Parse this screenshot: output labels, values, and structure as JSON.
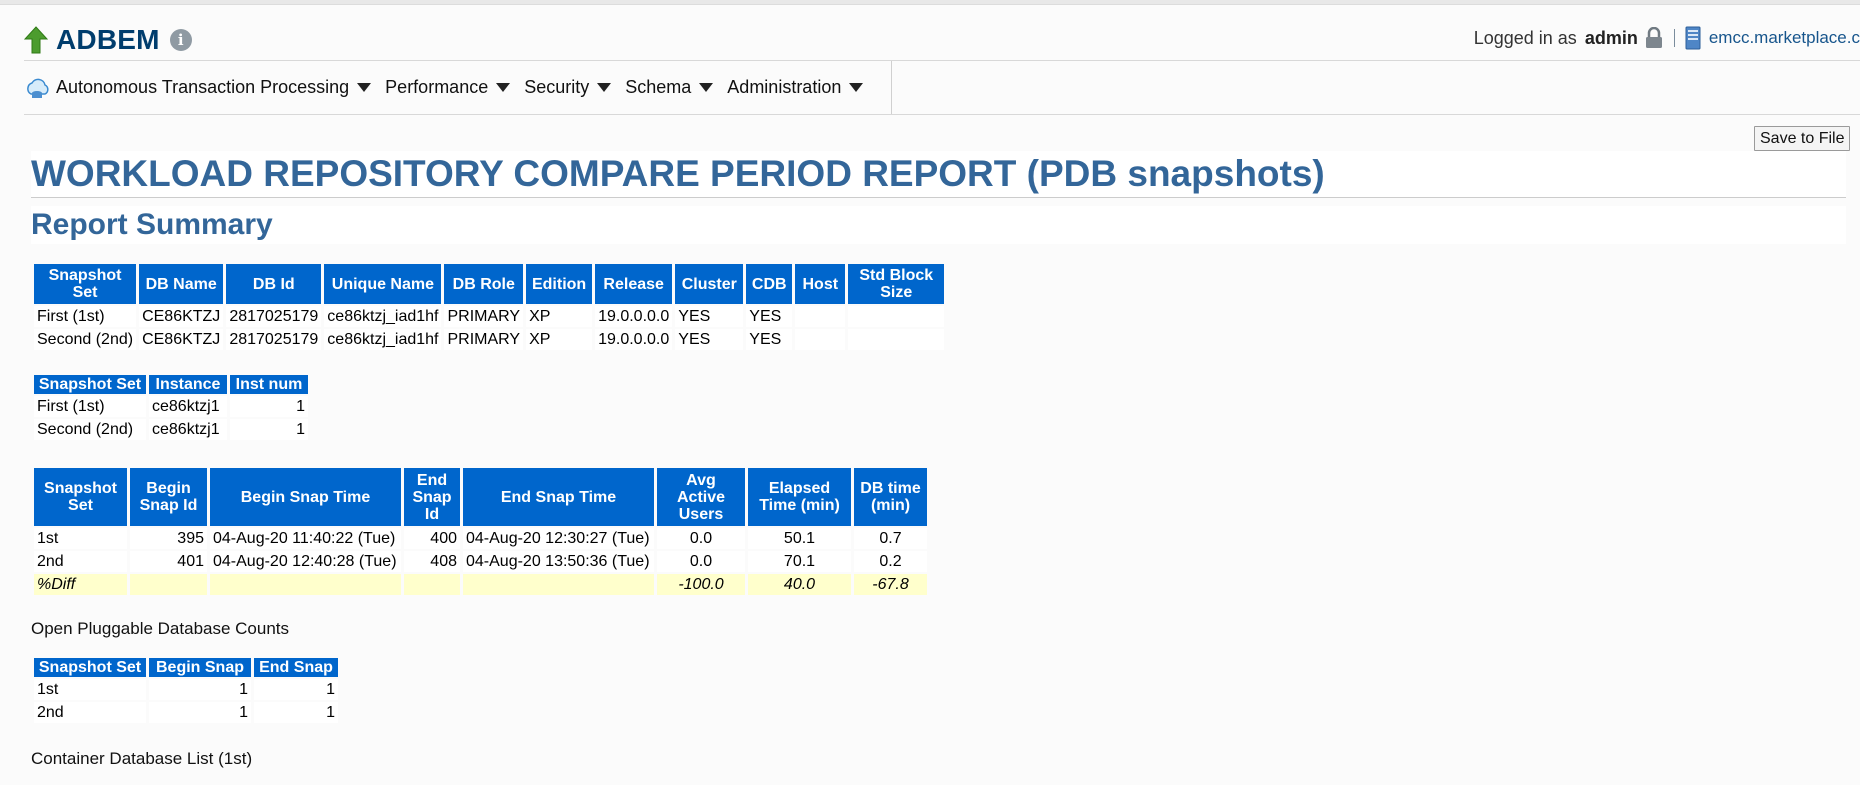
{
  "header": {
    "app_title": "ADBEM",
    "logged_in_label": "Logged in as",
    "username": "admin",
    "host": "emcc.marketplace.c"
  },
  "nav": {
    "items": [
      {
        "label": "Autonomous Transaction Processing"
      },
      {
        "label": "Performance"
      },
      {
        "label": "Security"
      },
      {
        "label": "Schema"
      },
      {
        "label": "Administration"
      }
    ]
  },
  "toolbar": {
    "save_label": "Save to File"
  },
  "report": {
    "title": "WORKLOAD REPOSITORY COMPARE PERIOD REPORT (PDB snapshots)",
    "section": "Report Summary",
    "db_table": {
      "headers": [
        "Snapshot Set",
        "DB Name",
        "DB Id",
        "Unique Name",
        "DB Role",
        "Edition",
        "Release",
        "Cluster",
        "CDB",
        "Host",
        "Std Block Size"
      ],
      "rows": [
        [
          "First (1st)",
          "CE86KTZJ",
          "2817025179",
          "ce86ktzj_iad1hf",
          "PRIMARY",
          "XP",
          "19.0.0.0.0",
          "YES",
          "YES",
          "",
          ""
        ],
        [
          "Second (2nd)",
          "CE86KTZJ",
          "2817025179",
          "ce86ktzj_iad1hf",
          "PRIMARY",
          "XP",
          "19.0.0.0.0",
          "YES",
          "YES",
          "",
          ""
        ]
      ]
    },
    "inst_table": {
      "headers": [
        "Snapshot Set",
        "Instance",
        "Inst num"
      ],
      "rows": [
        [
          "First (1st)",
          "ce86ktzj1",
          "1"
        ],
        [
          "Second (2nd)",
          "ce86ktzj1",
          "1"
        ]
      ]
    },
    "snap_table": {
      "headers": [
        "Snapshot Set",
        "Begin Snap Id",
        "Begin Snap Time",
        "End Snap Id",
        "End Snap Time",
        "Avg Active Users",
        "Elapsed Time (min)",
        "DB time (min)"
      ],
      "rows": [
        [
          "1st",
          "395",
          "04-Aug-20 11:40:22 (Tue)",
          "400",
          "04-Aug-20 12:30:27 (Tue)",
          "0.0",
          "50.1",
          "0.7"
        ],
        [
          "2nd",
          "401",
          "04-Aug-20 12:40:28 (Tue)",
          "408",
          "04-Aug-20 13:50:36 (Tue)",
          "0.0",
          "70.1",
          "0.2"
        ]
      ],
      "diff_row": [
        "%Diff",
        "",
        "",
        "",
        "",
        "-100.0",
        "40.0",
        "-67.8"
      ]
    },
    "pdb_counts_label": "Open Pluggable Database Counts",
    "pdb_table": {
      "headers": [
        "Snapshot Set",
        "Begin Snap",
        "End Snap"
      ],
      "rows": [
        [
          "1st",
          "1",
          "1"
        ],
        [
          "2nd",
          "1",
          "1"
        ]
      ]
    },
    "container_list_label": "Container Database List (1st)"
  }
}
